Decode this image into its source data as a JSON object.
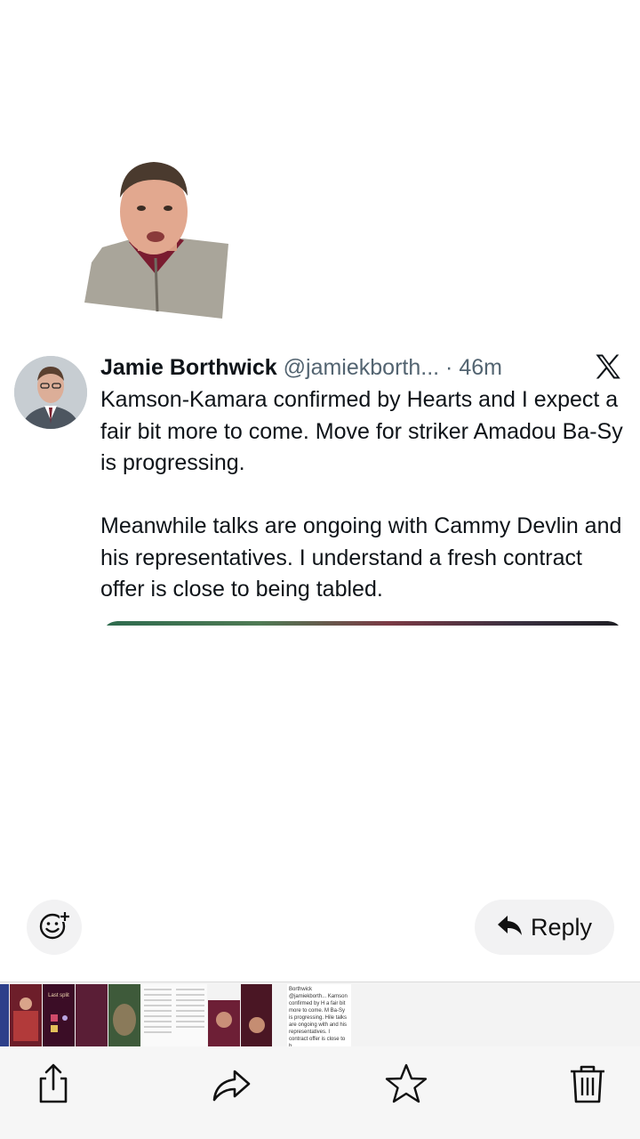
{
  "tweet": {
    "author": "Jamie Borthwick",
    "handle": "@jamiekborth...",
    "separator": " · ",
    "time": "46m",
    "paragraph1": "Kamson-Kamara confirmed by Hearts and I expect a fair bit more to come. Move for striker Amadou Ba-Sy is progressing.",
    "paragraph2": "Meanwhile talks are ongoing with Cammy Devlin and his representatives. I understand a fresh contract offer is close to being tabled.",
    "platform_icon": "x-logo-icon"
  },
  "actions": {
    "emoji_icon": "emoji-add-icon",
    "reply_label": "Reply",
    "reply_icon": "reply-arrow-icon"
  },
  "thumbnails": {
    "thumb2_title": "Last split",
    "thumb4_text": "Borthwick @jamiekborth... Kamson confirmed by H a fair bit more to come. M Ba-Sy is progressing. Hile talks are ongoing with and his representatives. I contract offer is close to b"
  },
  "toolbar": {
    "icons": [
      "share-icon",
      "forward-icon",
      "star-icon",
      "trash-icon"
    ]
  },
  "colors": {
    "text": "#0f1419",
    "secondary": "#536471",
    "button_bg": "#f2f2f3"
  }
}
